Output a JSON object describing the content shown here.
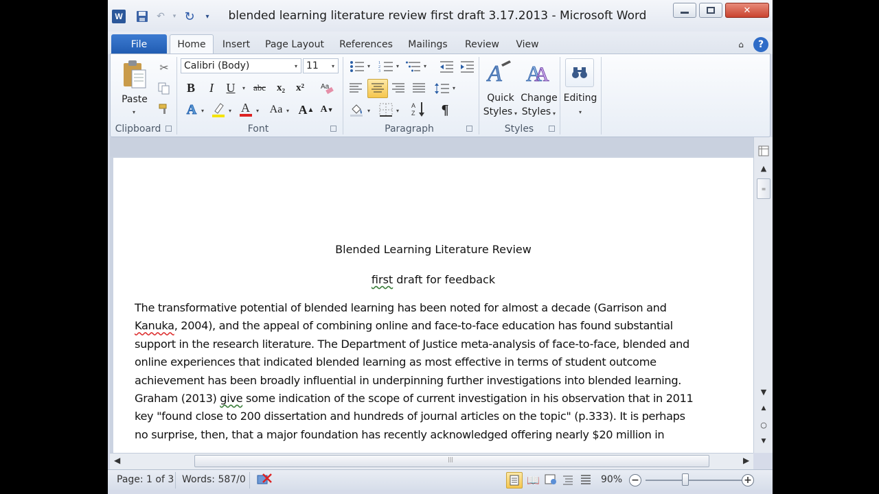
{
  "window": {
    "title": "blended learning literature review first draft 3.17.2013  -  Microsoft Word",
    "app_icon": "W",
    "min_glyph": "▭",
    "max_glyph": "▢",
    "close_glyph": "✕"
  },
  "qat": {
    "save_icon": "save-icon",
    "undo_icon": "undo-icon",
    "redo_icon": "redo-icon",
    "customize_icon": "chevron-down-icon"
  },
  "tabs": [
    "File",
    "Home",
    "Insert",
    "Page Layout",
    "References",
    "Mailings",
    "Review",
    "View"
  ],
  "ribbon": {
    "clipboard": {
      "label": "Clipboard",
      "paste": "Paste"
    },
    "font": {
      "label": "Font",
      "font_name": "Calibri (Body)",
      "font_size": "11",
      "bold": "B",
      "italic": "I",
      "underline": "U",
      "strike": "abc",
      "subscript": "x₂",
      "superscript": "x²",
      "grow": "A",
      "change_case": "Aa"
    },
    "paragraph": {
      "label": "Paragraph",
      "pilcrow": "¶"
    },
    "styles": {
      "label": "Styles",
      "quick_styles": [
        "Quick",
        "Styles"
      ],
      "change_styles": [
        "Change",
        "Styles"
      ]
    },
    "editing": {
      "label": "Editing"
    }
  },
  "document": {
    "title": "Blended Learning Literature Review",
    "subtitle_a": "first",
    "subtitle_b": " draft for feedback",
    "lines": [
      [
        "The transformative potential of blended learning has been noted for almost a decade (Garrison and"
      ],
      [
        "Kanuka",
        ", 2004), and the appeal of combining online and face-to-face education has found substantial"
      ],
      [
        "support in the research literature. The Department of Justice meta-analysis of face-to-face, blended and"
      ],
      [
        "online experiences that indicated blended learning as most effective in terms of student outcome"
      ],
      [
        "achievement has been broadly influential in underpinning further investigations into blended learning."
      ],
      [
        "Graham (2013) ",
        "give",
        " some indication of the scope of current investigation in his observation that in 2011"
      ],
      [
        "key \"found close to 200 dissertation and hundreds of journal articles on the topic\" (p.333). It is perhaps"
      ],
      [
        "no surprise, then, that a major foundation has recently acknowledged offering nearly $20 million in"
      ]
    ]
  },
  "status": {
    "page": "Page: 1 of 3",
    "words": "Words: 587/0",
    "zoom": "90%"
  }
}
